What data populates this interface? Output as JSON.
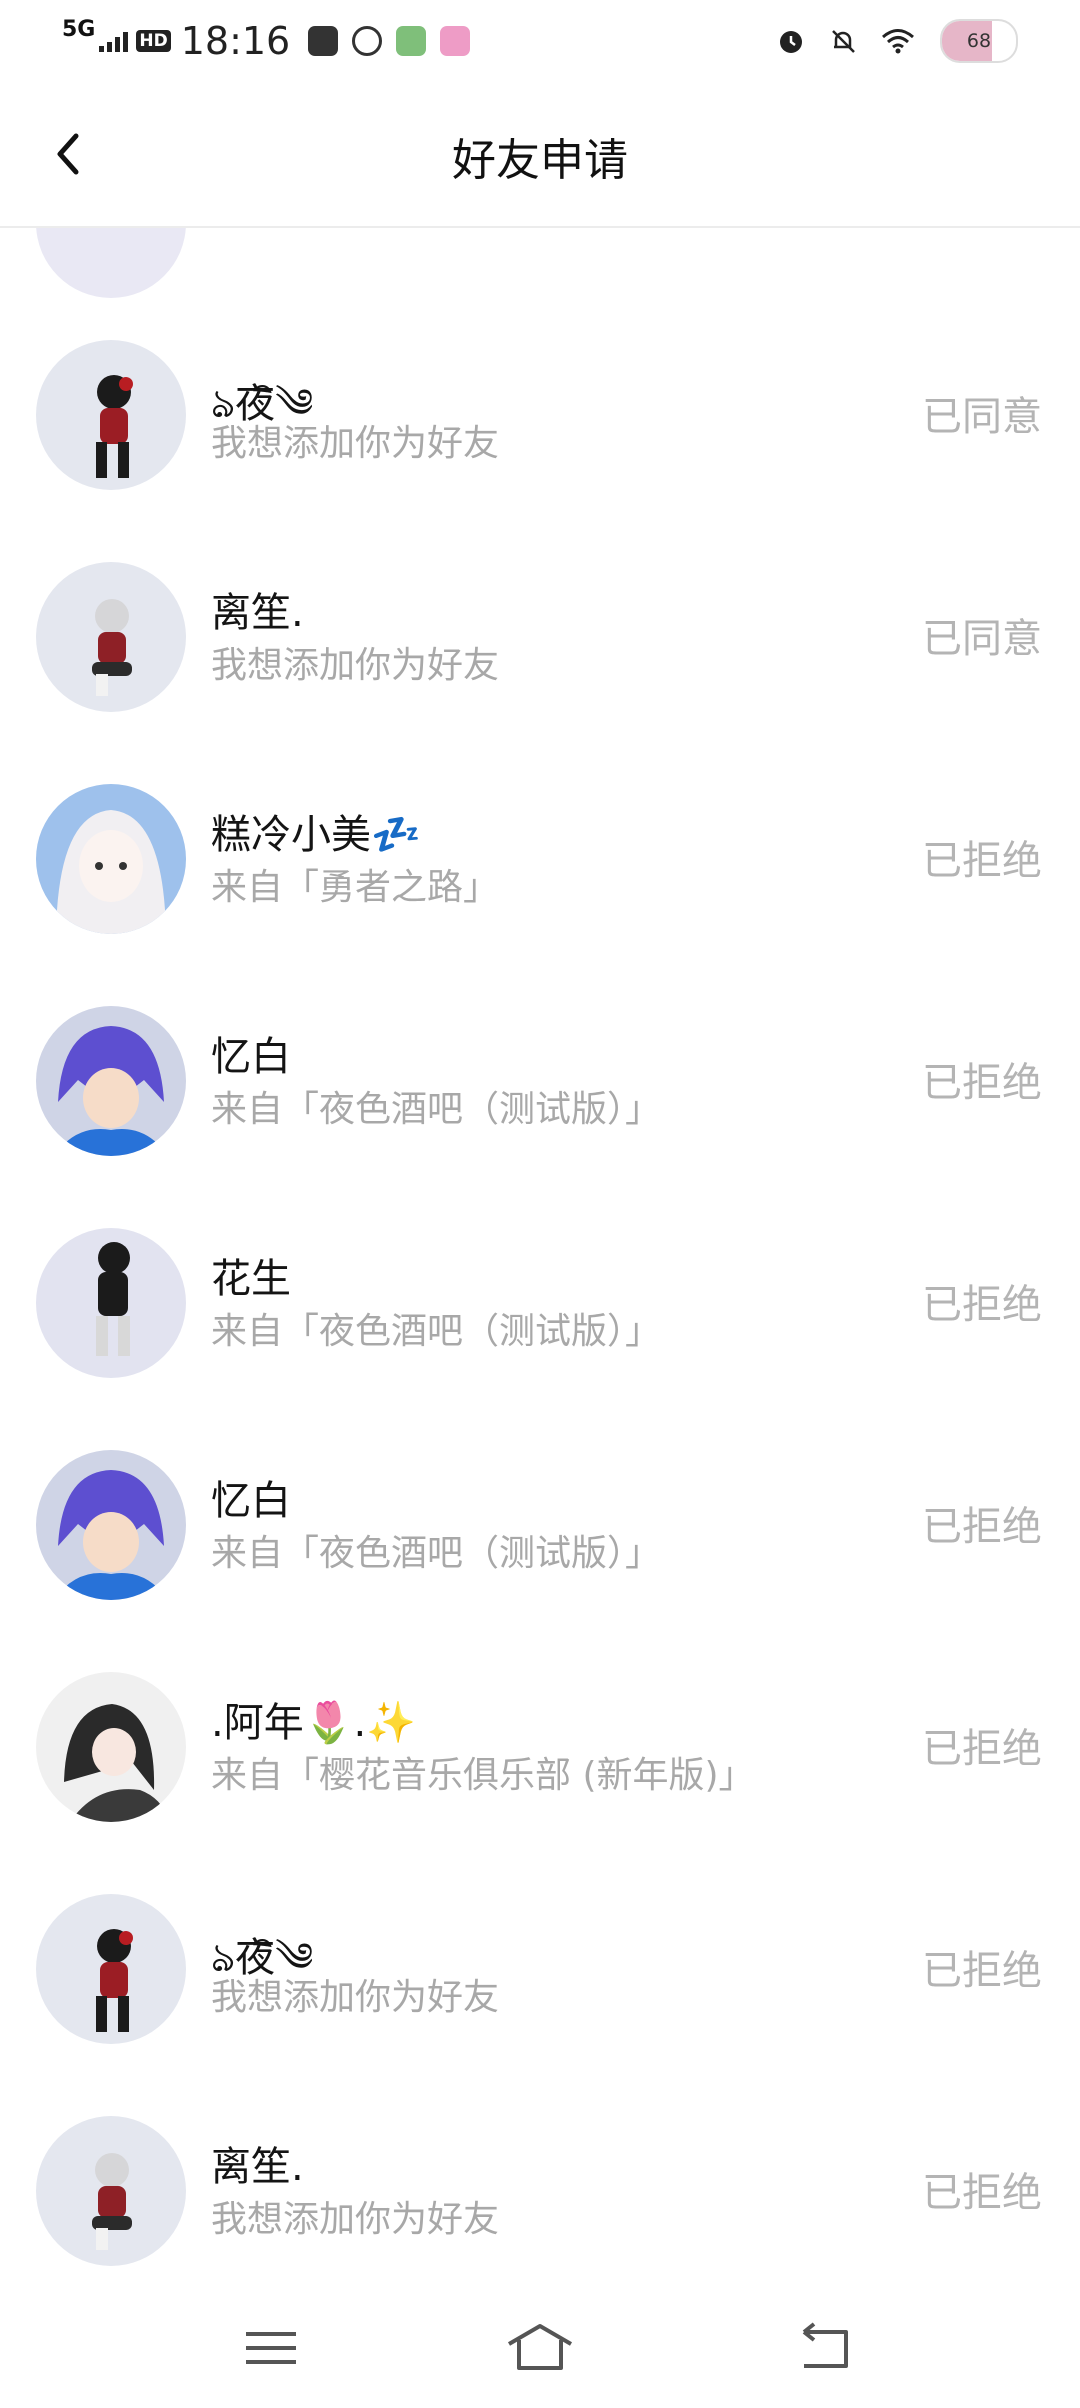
{
  "status_bar": {
    "network": "5G",
    "hd": "HD",
    "time": "18:16",
    "battery": "68",
    "battery_level": 0.68,
    "icons": [
      "signal-icon",
      "message-app-icon",
      "at-app-icon",
      "green-app-icon",
      "pink-app-icon",
      "alarm-icon",
      "mute-bell-icon",
      "wifi-icon",
      "battery-icon"
    ]
  },
  "header": {
    "title": "好友申请"
  },
  "requests": [
    {
      "name": "ঌ夜ิ༄",
      "sub": "我想添加你为好友",
      "status": "已同意"
    },
    {
      "name": "离笙.",
      "sub": "我想添加你为好友",
      "status": "已同意"
    },
    {
      "name": "糕冷小美💤",
      "sub": "来自「勇者之路」",
      "status": "已拒绝"
    },
    {
      "name": "忆白",
      "sub": "来自「夜色酒吧（测试版）」",
      "status": "已拒绝"
    },
    {
      "name": "花生",
      "sub": "来自「夜色酒吧（测试版）」",
      "status": "已拒绝"
    },
    {
      "name": "忆白",
      "sub": "来自「夜色酒吧（测试版）」",
      "status": "已拒绝"
    },
    {
      "name": ".阿年🌷.✨",
      "sub": "来自「樱花音乐俱乐部 (新年版)」",
      "status": "已拒绝"
    },
    {
      "name": "ঌ夜ิ༄",
      "sub": "我想添加你为好友",
      "status": "已拒绝"
    },
    {
      "name": "离笙.",
      "sub": "我想添加你为好友",
      "status": "已拒绝"
    }
  ],
  "colors": {
    "status_text": "#b4b4b4",
    "subtitle_text": "#a8a8a8",
    "battery_fill": "#e6b6c8"
  }
}
